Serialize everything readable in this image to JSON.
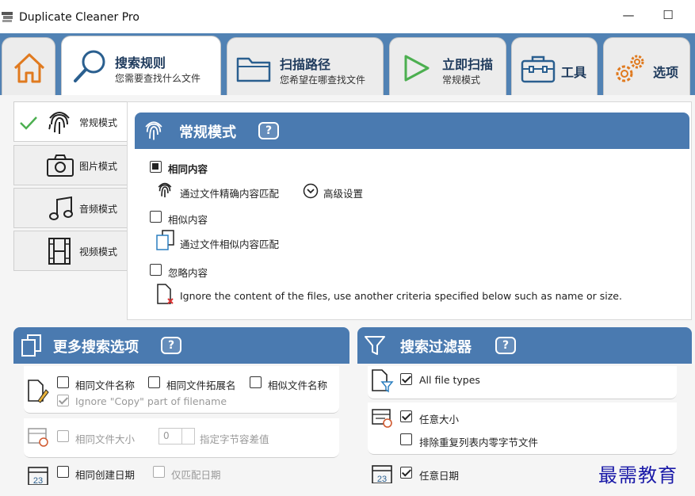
{
  "window": {
    "title": "Duplicate Cleaner Pro",
    "minimize_glyph": "—",
    "maximize_glyph": "☐"
  },
  "tabs": [
    {
      "id": "home",
      "icon": "home-icon"
    },
    {
      "id": "search_rules",
      "title": "搜索规则",
      "subtitle": "您需要查找什么文件",
      "icon": "magnifier-icon",
      "active": true
    },
    {
      "id": "scan_path",
      "title": "扫描路径",
      "subtitle": "您希望在哪查找文件",
      "icon": "folder-icon"
    },
    {
      "id": "scan_now",
      "title": "立即扫描",
      "subtitle": "常规模式",
      "icon": "play-icon"
    },
    {
      "id": "tools",
      "title": "工具",
      "icon": "toolbox-icon"
    },
    {
      "id": "options",
      "title": "选项",
      "icon": "gears-icon"
    }
  ],
  "modes": [
    {
      "label": "常规模式",
      "icon": "fingerprint-icon",
      "selected": true
    },
    {
      "label": "图片模式",
      "icon": "camera-icon"
    },
    {
      "label": "音频模式",
      "icon": "music-note-icon"
    },
    {
      "label": "视频模式",
      "icon": "film-icon"
    }
  ],
  "mode_panel": {
    "title": "常规模式",
    "help": "?",
    "same_content": {
      "label": "相同内容",
      "state": "filled"
    },
    "exact_match": "通过文件精确内容匹配",
    "advanced": "高级设置",
    "similar_content": {
      "label": "相似内容",
      "checked": false
    },
    "similar_match": "通过文件相似内容匹配",
    "ignore_content": {
      "label": "忽略内容",
      "checked": false
    },
    "ignore_desc": "Ignore the content of the files, use another criteria specified below such as name or size."
  },
  "more_options": {
    "title": "更多搜索选项",
    "help": "?",
    "same_name": "相同文件名称",
    "same_ext": "相同文件拓展名",
    "similar_name": "相似文件名称",
    "ignore_copy": "Ignore \"Copy\" part of filename",
    "same_size": "相同文件大小",
    "size_value": "0",
    "size_suffix": "指定字节容差值",
    "same_created": "相同创建日期",
    "date_only": "仅匹配日期"
  },
  "filters": {
    "title": "搜索过滤器",
    "help": "?",
    "all_types": "All file types",
    "any_size": "任意大小",
    "exclude_zero": "排除重复列表内零字节文件",
    "any_date": "任意日期",
    "calendar_day": "23"
  },
  "watermark": "最需教育",
  "colors": {
    "accent": "#4a7ab0",
    "tabstrip": "#5182b4",
    "icon_orange": "#e07a1f",
    "icon_green": "#4caf50"
  }
}
